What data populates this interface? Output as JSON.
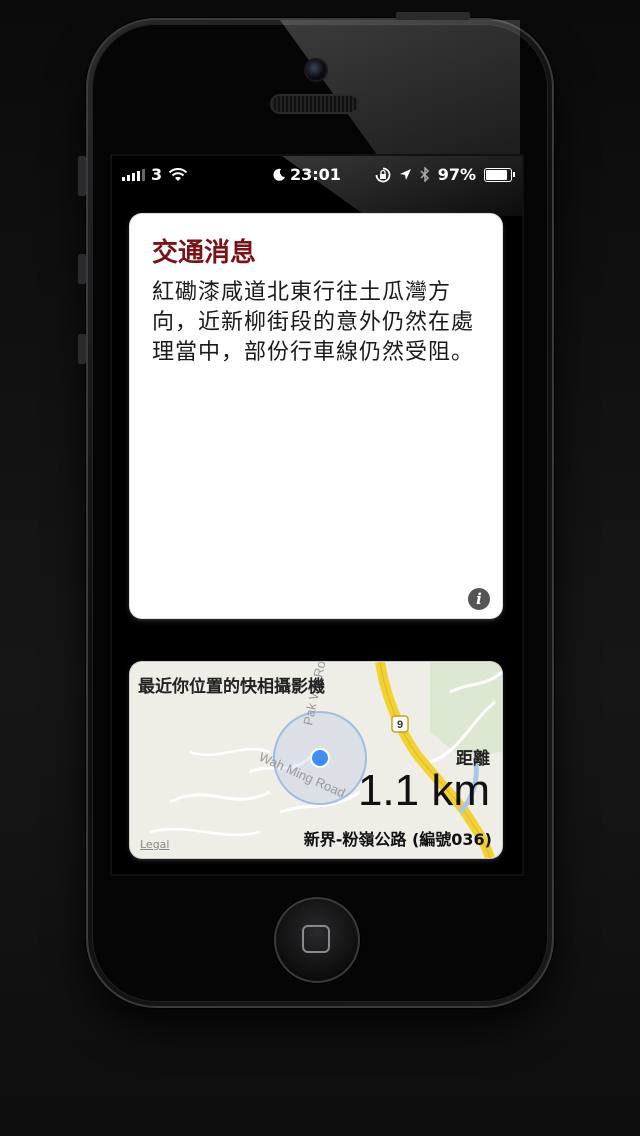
{
  "status_bar": {
    "carrier": "3",
    "time": "23:01",
    "battery": "97%",
    "battery_level": 0.97
  },
  "traffic_card": {
    "title": "交通消息",
    "message": "紅磡漆咸道北東行往土瓜灣方向，近新柳街段的意外仍然在處理當中，部份行車線仍然受阻。"
  },
  "map_card": {
    "caption": "最近你位置的快相攝影機",
    "distance_label": "距離",
    "distance_value": "1.1 km",
    "camera_name": "新界-粉嶺公路 (編號036)",
    "legal": "Legal",
    "road_label_1": "Wah Ming Road",
    "road_label_2": "Pak Wo Road",
    "route_number": "9"
  },
  "colors": {
    "title_red": "#7a1218",
    "road_yellow": "#f2d232",
    "location_blue": "#3d8ff5"
  }
}
